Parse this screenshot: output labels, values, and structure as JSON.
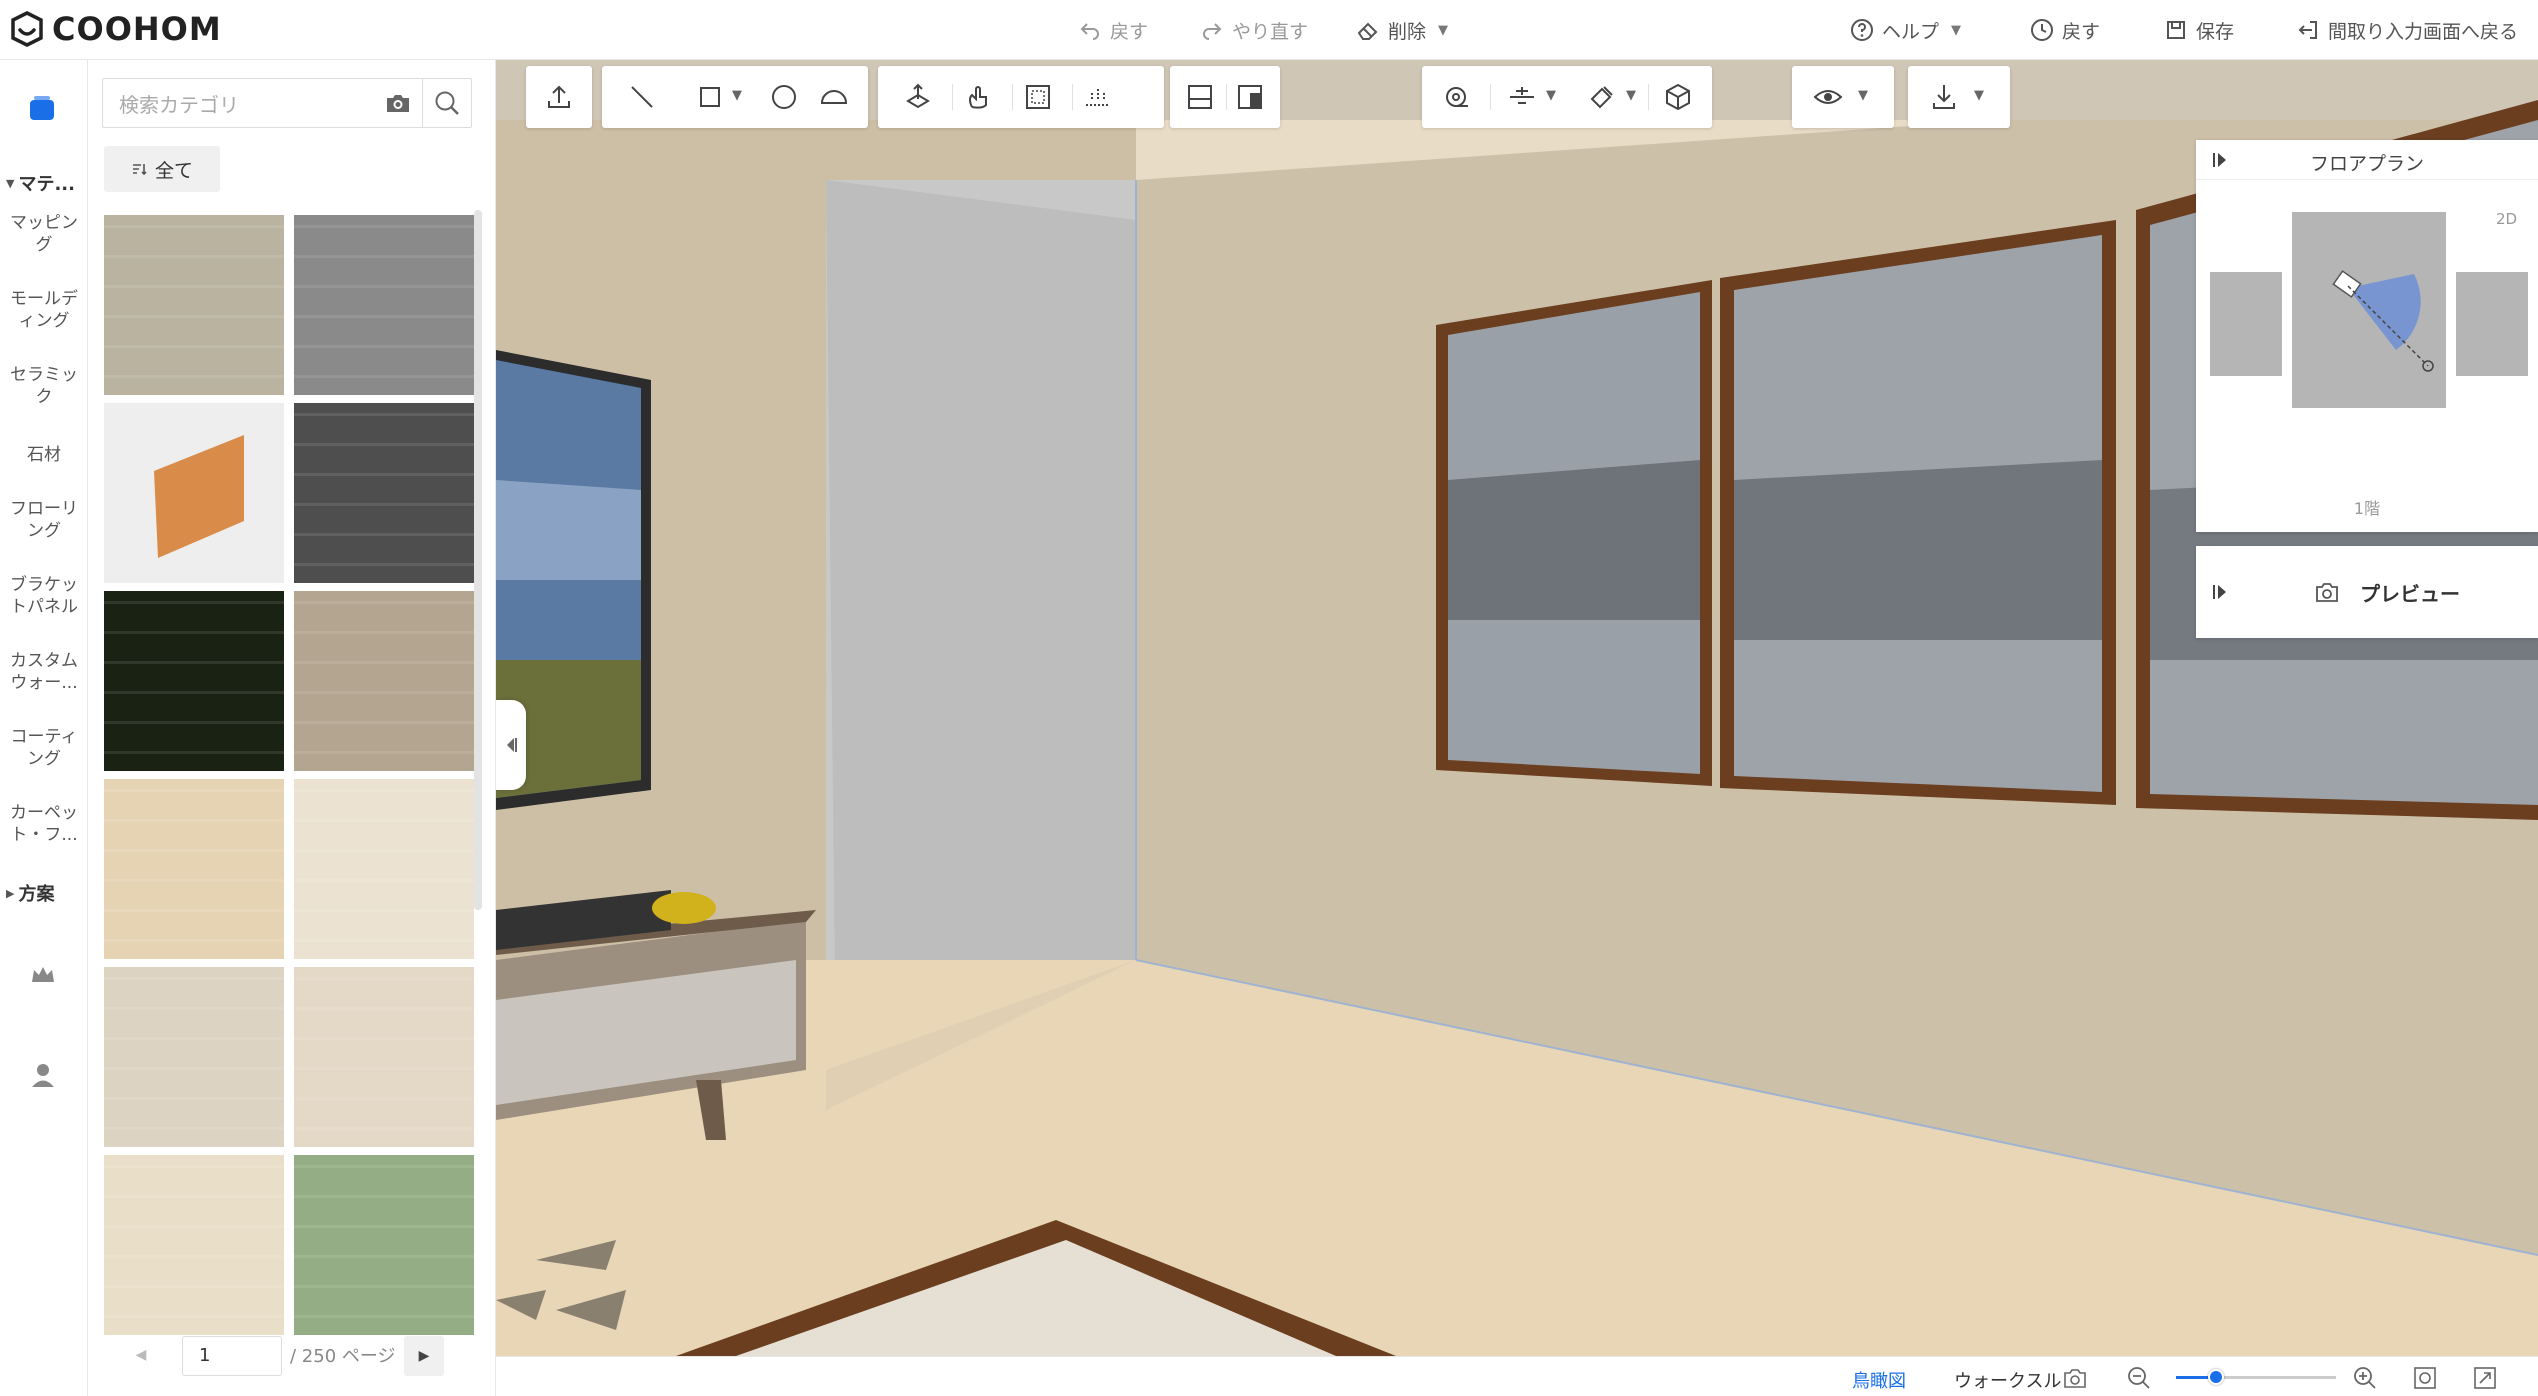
{
  "app": {
    "logo_text": "COOHOM"
  },
  "header": {
    "undo": "戻す",
    "redo": "やり直す",
    "delete": "削除",
    "help": "ヘルプ",
    "history": "戻す",
    "save": "保存",
    "back_to_plan": "間取り入力画面へ戻る"
  },
  "rail": {
    "group_material": "マテ...",
    "items": [
      "マッピング",
      "モールディング",
      "セラミック",
      "石材",
      "フローリング",
      "ブラケットパネル",
      "カスタムウォー...",
      "コーティング",
      "カーペット・フ..."
    ],
    "group_plan": "方案"
  },
  "catalog": {
    "search_placeholder": "検索カテゴリ",
    "all_label": "全て",
    "thumbnails": [
      {
        "name": "birch-wood",
        "color": "#b9b3a0"
      },
      {
        "name": "gray-fabric",
        "color": "#8a8a8a"
      },
      {
        "name": "wood-baseboard",
        "color": "#d98c4a"
      },
      {
        "name": "dark-concrete",
        "color": "#4e4e4e"
      },
      {
        "name": "dark-green",
        "color": "#1a2214"
      },
      {
        "name": "oak-plank",
        "color": "#b3a58f"
      },
      {
        "name": "light-maple",
        "color": "#e6d3b4"
      },
      {
        "name": "cream-marble",
        "color": "#ebe2d2"
      },
      {
        "name": "pale-ash",
        "color": "#ddd3c2"
      },
      {
        "name": "pale-birch",
        "color": "#e4d9c7"
      },
      {
        "name": "beige-plaid",
        "color": "#e9dfc9"
      },
      {
        "name": "sage-green",
        "color": "#95ad84"
      }
    ],
    "page_current": "1",
    "page_total": "/ 250 ページ"
  },
  "floorplan": {
    "title": "フロアプラン",
    "mode": "2D",
    "floor": "1階"
  },
  "preview": {
    "label": "プレビュー"
  },
  "statusbar": {
    "view_bird": "鳥瞰図",
    "view_walk": "ウォークスル",
    "zoom_level": 0.25
  },
  "colors": {
    "accent": "#1a6fe8",
    "wall": "#cbbfaa",
    "floor": "#e9d7b8",
    "frame": "#6b3e1f"
  }
}
